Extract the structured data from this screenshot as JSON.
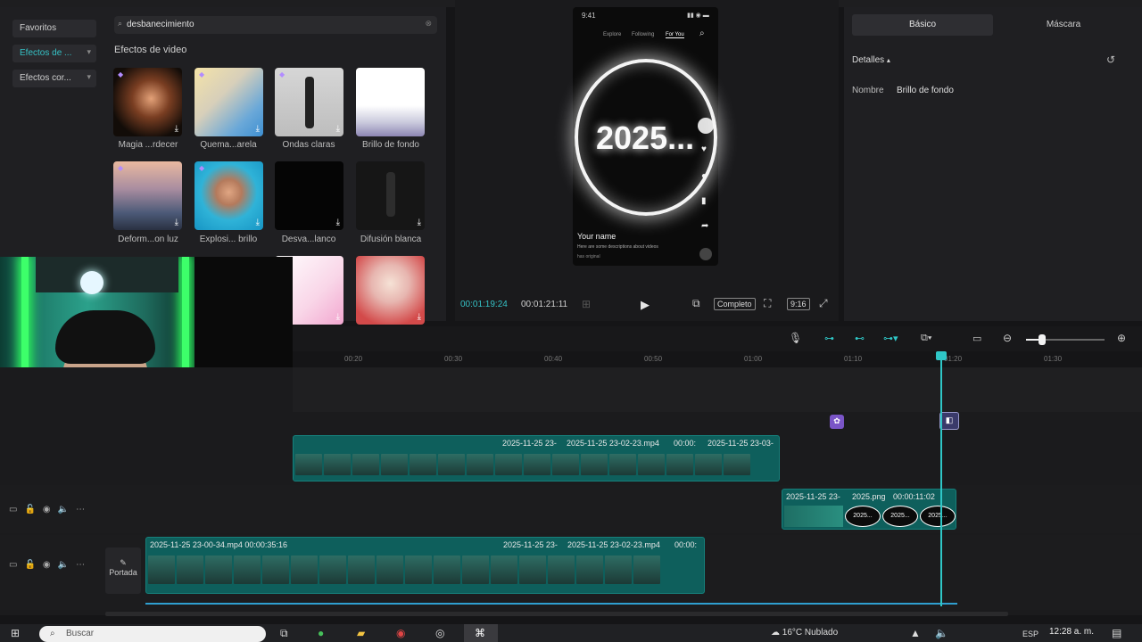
{
  "left_panel": {
    "categories": [
      {
        "label": "Favoritos",
        "active": false
      },
      {
        "label": "Efectos de ...",
        "active": true
      },
      {
        "label": "Efectos cor...",
        "active": false
      }
    ],
    "search_value": "desbanecimiento",
    "section_title": "Efectos de video",
    "effects": [
      {
        "label": "Magia ...rdecer",
        "premium": true,
        "download": true
      },
      {
        "label": "Quema...arela",
        "premium": true,
        "download": true
      },
      {
        "label": "Ondas claras",
        "premium": true,
        "download": true
      },
      {
        "label": "Brillo de fondo",
        "premium": false,
        "download": false
      },
      {
        "label": "Deform...on luz",
        "premium": true,
        "download": true
      },
      {
        "label": "Explosi... brillo",
        "premium": true,
        "download": true
      },
      {
        "label": "Desva...lanco",
        "premium": false,
        "download": true
      },
      {
        "label": "Difusión blanca",
        "premium": false,
        "download": true
      },
      {
        "label": "",
        "premium": false,
        "download": true
      },
      {
        "label": "",
        "premium": false,
        "download": true
      }
    ]
  },
  "preview": {
    "phone": {
      "status_time": "9:41",
      "tabs": [
        "Explore",
        "Following",
        "For You"
      ],
      "year_text": "2025...",
      "user_name": "Your name",
      "caption": "Here are some descriptions about videos",
      "sound": "has original"
    },
    "current_time": "00:01:19:24",
    "total_time": "00:01:21:11",
    "complete_label": "Completo",
    "ratio_label": "9:16"
  },
  "right_panel": {
    "tabs": [
      {
        "label": "Básico",
        "active": true
      },
      {
        "label": "Máscara",
        "active": false
      }
    ],
    "details_label": "Detalles",
    "name_label": "Nombre",
    "name_value": "Brillo de fondo"
  },
  "timeline": {
    "ruler_ticks": [
      "00:20",
      "00:30",
      "00:40",
      "00:50",
      "01:00",
      "01:10",
      "01:20",
      "01:30"
    ],
    "main_track": {
      "clips": [
        "2025-11-25 23-00-34.mp4  00:00:35:16",
        "2025-11-25 23-",
        "2025-11-25 23-02-23.mp4",
        "00:00:"
      ]
    },
    "overlay_track": {
      "clips": [
        "2025-11-25 23-",
        "2025-11-25 23-02-23.mp4",
        "00:00:",
        "2025-11-25 23-03-"
      ]
    },
    "image_track": {
      "clips": [
        "2025-11-25 23-",
        "2025.png",
        "00:00:11:02"
      ],
      "frame_label": "2025..."
    },
    "cover_label": "Portada"
  },
  "taskbar": {
    "search_placeholder": "Buscar",
    "weather": "16°C  Nublado",
    "lang": "ESP",
    "clock": "12:28 a. m."
  }
}
